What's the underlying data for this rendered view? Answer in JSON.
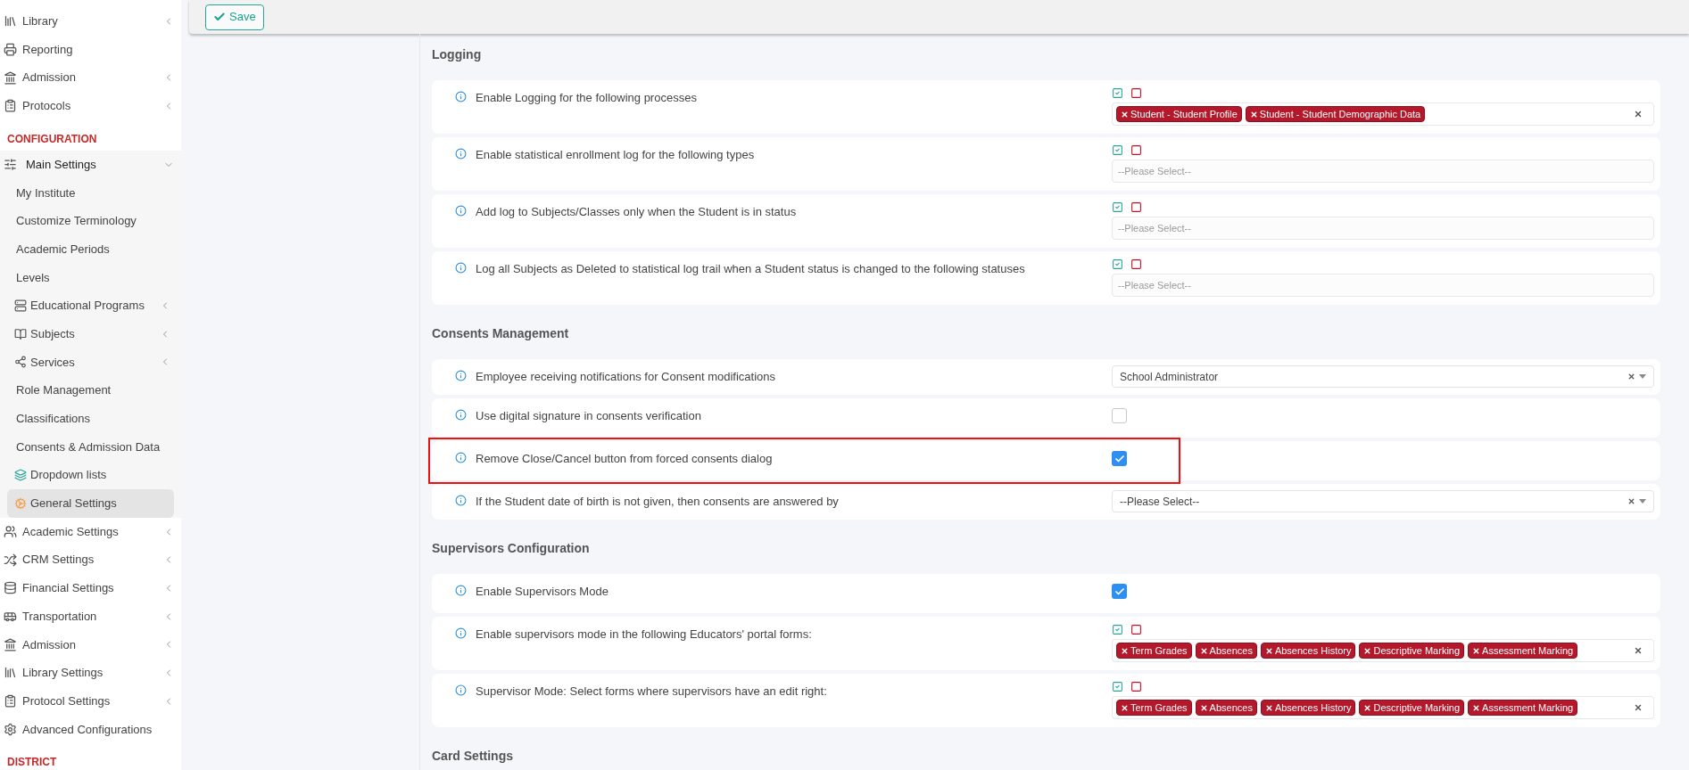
{
  "sidebar": {
    "items": [
      {
        "kind": "item",
        "label": "Library",
        "has_submenu": true,
        "selected": false
      },
      {
        "kind": "item",
        "label": "Reporting",
        "has_submenu": false,
        "selected": false
      },
      {
        "kind": "item",
        "label": "Admission",
        "has_submenu": true,
        "selected": false
      },
      {
        "kind": "item",
        "label": "Protocols",
        "has_submenu": true,
        "selected": false
      },
      {
        "kind": "section",
        "label": "CONFIGURATION"
      },
      {
        "kind": "item",
        "label": "Main Settings",
        "has_submenu": true,
        "expanded": true,
        "selected": false,
        "children": [
          {
            "label": "My Institute",
            "has_submenu": false,
            "selected": false
          },
          {
            "label": "Customize Terminology",
            "has_submenu": false,
            "selected": false
          },
          {
            "label": "Academic Periods",
            "has_submenu": false,
            "selected": false
          },
          {
            "label": "Levels",
            "has_submenu": false,
            "selected": false
          },
          {
            "label": "Educational Programs",
            "has_submenu": true,
            "selected": false
          },
          {
            "label": "Subjects",
            "has_submenu": true,
            "selected": false
          },
          {
            "label": "Services",
            "has_submenu": true,
            "selected": false
          },
          {
            "label": "Role Management",
            "has_submenu": false,
            "selected": false
          },
          {
            "label": "Classifications",
            "has_submenu": false,
            "selected": false
          },
          {
            "label": "Consents & Admission Data",
            "has_submenu": false,
            "selected": false
          },
          {
            "label": "Dropdown lists",
            "has_submenu": false,
            "selected": false
          },
          {
            "label": "General Settings",
            "has_submenu": false,
            "selected": true
          }
        ]
      },
      {
        "kind": "item",
        "label": "Academic Settings",
        "has_submenu": true,
        "selected": false
      },
      {
        "kind": "item",
        "label": "CRM Settings",
        "has_submenu": true,
        "selected": false
      },
      {
        "kind": "item",
        "label": "Financial Settings",
        "has_submenu": true,
        "selected": false
      },
      {
        "kind": "item",
        "label": "Transportation",
        "has_submenu": true,
        "selected": false
      },
      {
        "kind": "item",
        "label": "Admission",
        "has_submenu": true,
        "selected": false
      },
      {
        "kind": "item",
        "label": "Library Settings",
        "has_submenu": true,
        "selected": false
      },
      {
        "kind": "item",
        "label": "Protocol Settings",
        "has_submenu": true,
        "selected": false
      },
      {
        "kind": "item",
        "label": "Advanced Configurations",
        "has_submenu": false,
        "selected": false
      },
      {
        "kind": "section",
        "label": "DISTRICT"
      }
    ]
  },
  "toolbar": {
    "save_button": "Save"
  },
  "sections": [
    {
      "title": "Logging",
      "rows": [
        {
          "label": "Enable Logging for the following processes",
          "kind": "multiselect",
          "highlighted": false,
          "tags": [
            "Student - Student Profile",
            "Student - Student Demographic Data"
          ]
        },
        {
          "label": "Enable statistical enrollment log for the following types",
          "kind": "multiselect",
          "highlighted": false,
          "placeholder": "--Please Select--"
        },
        {
          "label": "Add log to Subjects/Classes only when the Student is in status",
          "kind": "multiselect",
          "highlighted": false,
          "placeholder": "--Please Select--"
        },
        {
          "label": "Log all Subjects as Deleted to statistical log trail when a Student status is changed to the following statuses",
          "kind": "multiselect",
          "highlighted": false,
          "placeholder": "--Please Select--"
        }
      ]
    },
    {
      "title": "Consents Management",
      "rows": [
        {
          "label": "Employee receiving notifications for Consent modifications",
          "kind": "select",
          "highlighted": false,
          "value": "School Administrator"
        },
        {
          "label": "Use digital signature in consents verification",
          "kind": "checkbox",
          "highlighted": false,
          "checked": false
        },
        {
          "label": "Remove Close/Cancel button from forced consents dialog",
          "kind": "checkbox",
          "highlighted": true,
          "checked": true
        },
        {
          "label": "If the Student date of birth is not given, then consents are answered by",
          "kind": "select",
          "highlighted": false,
          "value": "--Please Select--"
        }
      ]
    },
    {
      "title": "Supervisors Configuration",
      "rows": [
        {
          "label": "Enable Supervisors Mode",
          "kind": "checkbox",
          "highlighted": false,
          "checked": true
        },
        {
          "label": "Enable supervisors mode in the following Educators' portal forms:",
          "kind": "multiselect",
          "highlighted": false,
          "tags": [
            "Term Grades",
            "Absences",
            "Absences History",
            "Descriptive Marking",
            "Assessment Marking"
          ]
        },
        {
          "label": "Supervisor Mode: Select forms where supervisors have an edit right:",
          "kind": "multiselect",
          "highlighted": false,
          "tags": [
            "Term Grades",
            "Absences",
            "Absences History",
            "Descriptive Marking",
            "Assessment Marking"
          ]
        }
      ]
    },
    {
      "title": "Card Settings"
    }
  ]
}
